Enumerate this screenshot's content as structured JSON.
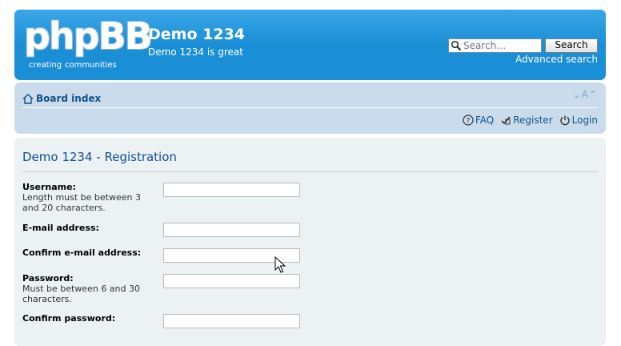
{
  "header": {
    "logo_word": "phpBB",
    "logo_tag_1": "creating",
    "logo_tag_2": "communities",
    "site_title": "Demo 1234",
    "site_description": "Demo 1234 is great",
    "search_placeholder": "Search…",
    "search_button": "Search",
    "advanced_search": "Advanced search"
  },
  "navbar": {
    "board_index": "Board index",
    "font_size_control": "⌄A⌃",
    "links": [
      {
        "label": "FAQ",
        "icon": "faq-icon"
      },
      {
        "label": "Register",
        "icon": "register-icon"
      },
      {
        "label": "Login",
        "icon": "login-icon"
      }
    ]
  },
  "registration": {
    "title": "Demo 1234 - Registration",
    "fields": [
      {
        "label": "Username:",
        "help": "Length must be between 3 and 20 characters.",
        "value": ""
      },
      {
        "label": "E-mail address:",
        "help": "",
        "value": ""
      },
      {
        "label": "Confirm e-mail address:",
        "help": "",
        "value": ""
      },
      {
        "label": "Password:",
        "help": "Must be between 6 and 30 characters.",
        "value": ""
      },
      {
        "label": "Confirm password:",
        "help": "",
        "value": ""
      }
    ]
  },
  "colors": {
    "header_blue": "#1b8fd6",
    "nav_blue": "#cadceb",
    "panel_bg": "#ecf1f3",
    "link_blue": "#105289"
  }
}
